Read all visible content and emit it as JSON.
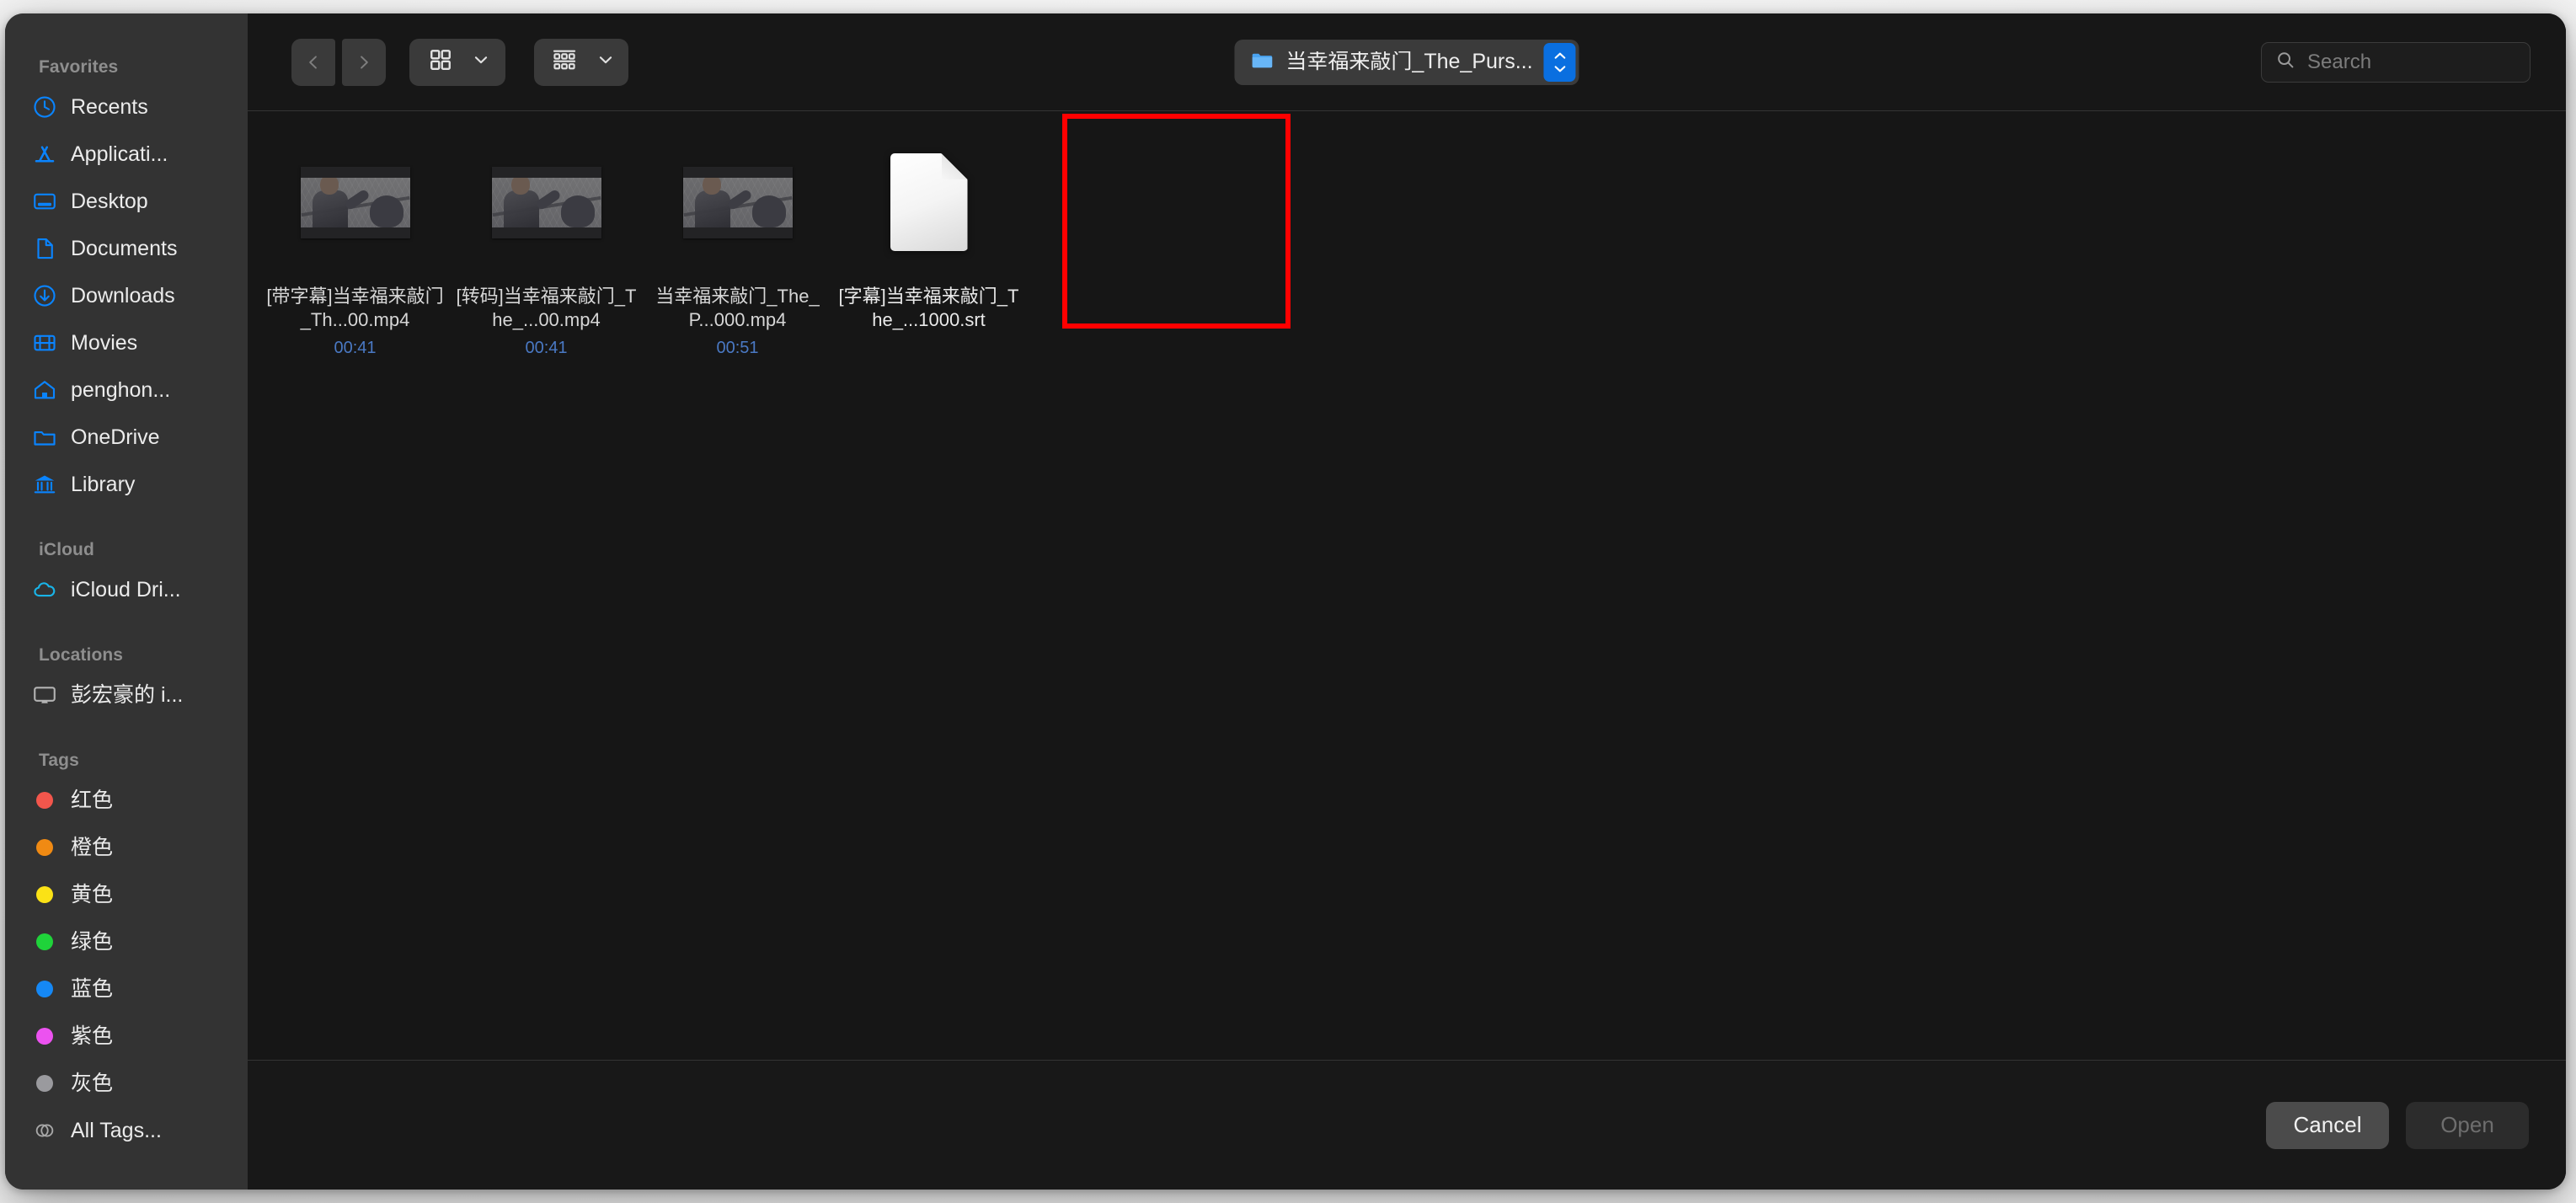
{
  "window": {
    "title": "Open File Dialog"
  },
  "sidebar": {
    "sections": [
      {
        "header": "Favorites",
        "items": [
          {
            "label": "Recents",
            "icon": "clock-icon"
          },
          {
            "label": "Applicati...",
            "icon": "applications-icon"
          },
          {
            "label": "Desktop",
            "icon": "desktop-icon"
          },
          {
            "label": "Documents",
            "icon": "document-icon"
          },
          {
            "label": "Downloads",
            "icon": "download-icon"
          },
          {
            "label": "Movies",
            "icon": "film-icon"
          },
          {
            "label": "penghon...",
            "icon": "home-icon"
          },
          {
            "label": "OneDrive",
            "icon": "folder-icon"
          },
          {
            "label": "Library",
            "icon": "library-icon"
          }
        ]
      },
      {
        "header": "iCloud",
        "items": [
          {
            "label": "iCloud Dri...",
            "icon": "cloud-icon"
          }
        ]
      },
      {
        "header": "Locations",
        "items": [
          {
            "label": "彭宏豪的 i...",
            "icon": "display-icon"
          }
        ]
      },
      {
        "header": "Tags",
        "items": [
          {
            "label": "红色",
            "icon": "tag-dot-icon",
            "color": "#f3564c"
          },
          {
            "label": "橙色",
            "icon": "tag-dot-icon",
            "color": "#f08a13"
          },
          {
            "label": "黄色",
            "icon": "tag-dot-icon",
            "color": "#fbe216"
          },
          {
            "label": "绿色",
            "icon": "tag-dot-icon",
            "color": "#1fd33a"
          },
          {
            "label": "蓝色",
            "icon": "tag-dot-icon",
            "color": "#1588f5"
          },
          {
            "label": "紫色",
            "icon": "tag-dot-icon",
            "color": "#ec52f0"
          },
          {
            "label": "灰色",
            "icon": "tag-dot-icon",
            "color": "#9a9a9e"
          },
          {
            "label": "All Tags...",
            "icon": "all-tags-icon",
            "color": ""
          }
        ]
      }
    ]
  },
  "toolbar": {
    "back_icon": "chevron-left-icon",
    "forward_icon": "chevron-right-icon",
    "view_mode_icon": "grid-view-icon",
    "view_mode_chevron": "chevron-down-icon",
    "group_by_icon": "group-by-icon",
    "group_by_chevron": "chevron-down-icon",
    "path": {
      "label": "当幸福来敲门_The_Purs...",
      "folder_icon": "folder-icon",
      "stepper_icon": "stepper-updown-icon"
    },
    "search": {
      "placeholder": "Search",
      "value": "",
      "icon": "search-icon"
    }
  },
  "files": [
    {
      "name": "[带字幕]当幸福来敲门_Th...00.mp4",
      "duration": "00:41",
      "kind": "video",
      "selected": false
    },
    {
      "name": "[转码]当幸福来敲门_The_...00.mp4",
      "duration": "00:41",
      "kind": "video",
      "selected": false
    },
    {
      "name": "当幸福来敲门_The_P...000.mp4",
      "duration": "00:51",
      "kind": "video",
      "selected": false
    },
    {
      "name": "[字幕]当幸福来敲门_The_...1000.srt",
      "duration": "",
      "kind": "document",
      "selected": true
    }
  ],
  "annotation": {
    "color": "#ff0000",
    "target": "[字幕]当幸福来敲门_The_...1000.srt"
  },
  "footer": {
    "cancel_label": "Cancel",
    "open_label": "Open"
  }
}
